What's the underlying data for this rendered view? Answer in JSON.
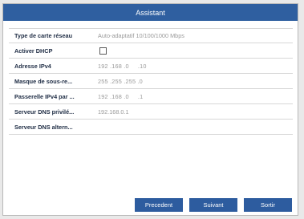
{
  "window": {
    "title": "Assistant"
  },
  "fields": [
    {
      "label": "Type de carte réseau",
      "value": "Auto-adaptatif 10/100/1000 Mbps"
    },
    {
      "label": "Activer DHCP",
      "checked": false
    },
    {
      "label": "Adresse IPv4",
      "value": "192 .168 .0     .10"
    },
    {
      "label": "Masque de sous-re...",
      "value": "255 .255 .255 .0"
    },
    {
      "label": "Passerelle IPv4 par ...",
      "value": "192 .168 .0     .1"
    },
    {
      "label": "Serveur DNS privilé...",
      "value": "192.168.0.1"
    },
    {
      "label": "Serveur DNS altern...",
      "value": ""
    }
  ],
  "buttons": {
    "previous": "Precedent",
    "next": "Suivant",
    "exit": "Sortir"
  },
  "colors": {
    "accent": "#2f5fa0"
  }
}
